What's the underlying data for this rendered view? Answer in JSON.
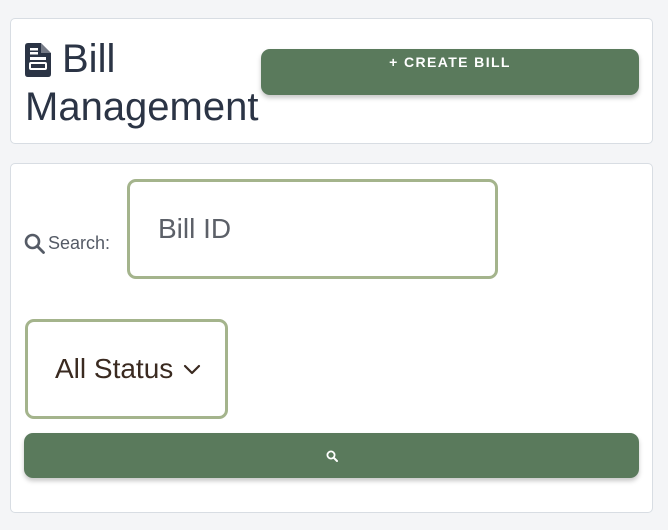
{
  "header": {
    "title_line1": "Bill",
    "title_line2": "Management",
    "title_icon": "file-invoice-icon",
    "create_button_label": "+ CREATE BILL"
  },
  "filters": {
    "search_label": "Search:",
    "search_icon": "search-icon",
    "search_placeholder": "Bill ID",
    "status_selected": "All Status",
    "status_icon": "chevron-down-icon",
    "search_button_icon": "search-icon"
  },
  "colors": {
    "primary_button": "#5a7a5c",
    "input_border": "#a4b48c",
    "title_text": "#2b3445"
  }
}
